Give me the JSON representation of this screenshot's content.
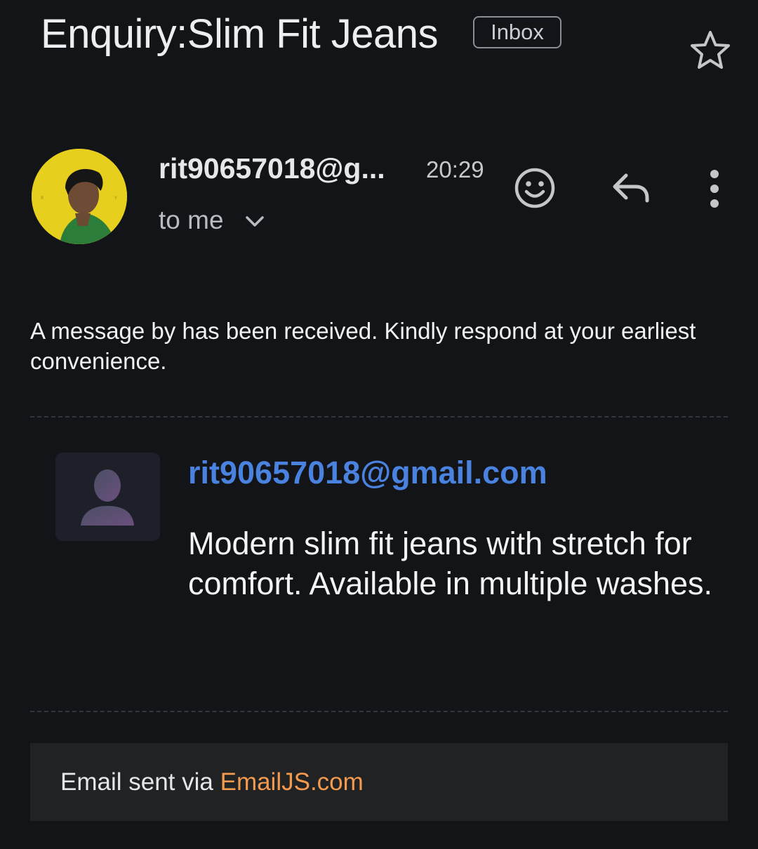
{
  "email": {
    "subject": "Enquiry:Slim Fit Jeans",
    "label": "Inbox",
    "sender_display": "rit90657018@g...",
    "time": "20:29",
    "recipient_summary": "to me"
  },
  "icons": {
    "star": "star-outline-icon",
    "emoji": "add-reaction-icon",
    "reply": "reply-icon",
    "more": "more-vert-icon",
    "expand": "chevron-down-icon",
    "placeholder": "person-placeholder-icon"
  },
  "body": {
    "intro": "A message by has been received. Kindly respond at your earliest convenience.",
    "card": {
      "email": "rit90657018@gmail.com",
      "message": "Modern slim fit jeans with stretch for comfort. Available in multiple washes."
    },
    "footer": {
      "prefix": "Email sent via ",
      "link": "EmailJS.com"
    }
  },
  "colors": {
    "background": "#131418",
    "link_blue": "#4a82e0",
    "link_orange": "#f39a4e",
    "avatar_yellow": "#e7cf1e"
  }
}
